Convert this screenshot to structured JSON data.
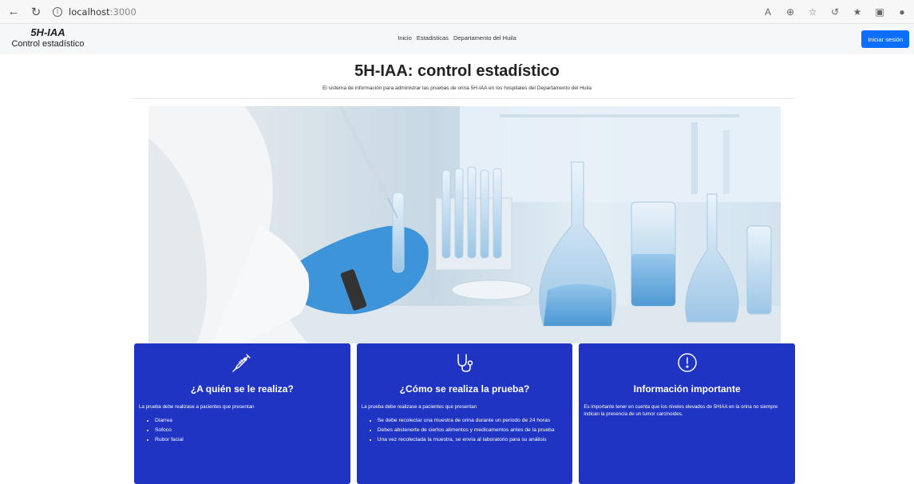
{
  "browser": {
    "url_host": "localhost",
    "url_port": ":3000"
  },
  "header": {
    "brand_title": "5H-IAA",
    "brand_subtitle": "Control estadístico",
    "nav": [
      "Inicio",
      "Estadisticas",
      "Departamento del Huila"
    ],
    "login_label": "Iniciar sesión"
  },
  "hero": {
    "title": "5H-IAA: control estadístico",
    "description": "El sistema de información para administrar las pruebas de orina 5H-IAA en los hospitales del Departamento del Huila"
  },
  "cards": [
    {
      "icon": "syringe-icon",
      "title": "¿A quién se le realiza?",
      "intro": "La prueba debe realizase a pacientes que presentan",
      "items": [
        "Diarrea",
        "Sofoco",
        "Rubor facial"
      ]
    },
    {
      "icon": "stethoscope-icon",
      "title": "¿Cómo se realiza la prueba?",
      "intro": "La prueba debe realizase a pacientes que presentan",
      "items": [
        "Se debe recolectar una muestra de orina durante un periodo de 24 horas",
        "Debes abstenerte de ciertos alimentos y medicamentos antes de la prueba",
        "Una vez recolectada la muestra, se envía al laboratorio para su análisis"
      ]
    },
    {
      "icon": "exclamation-circle-icon",
      "title": "Información importante",
      "intro": "Es importante tener en cuenta que los niveles elevados de 5HIAA en la orina no siempre indican la presencia de un tumor carcinoides.",
      "items": []
    }
  ],
  "colors": {
    "card_bg": "#1f34c3",
    "primary_button": "#0d6efd"
  }
}
